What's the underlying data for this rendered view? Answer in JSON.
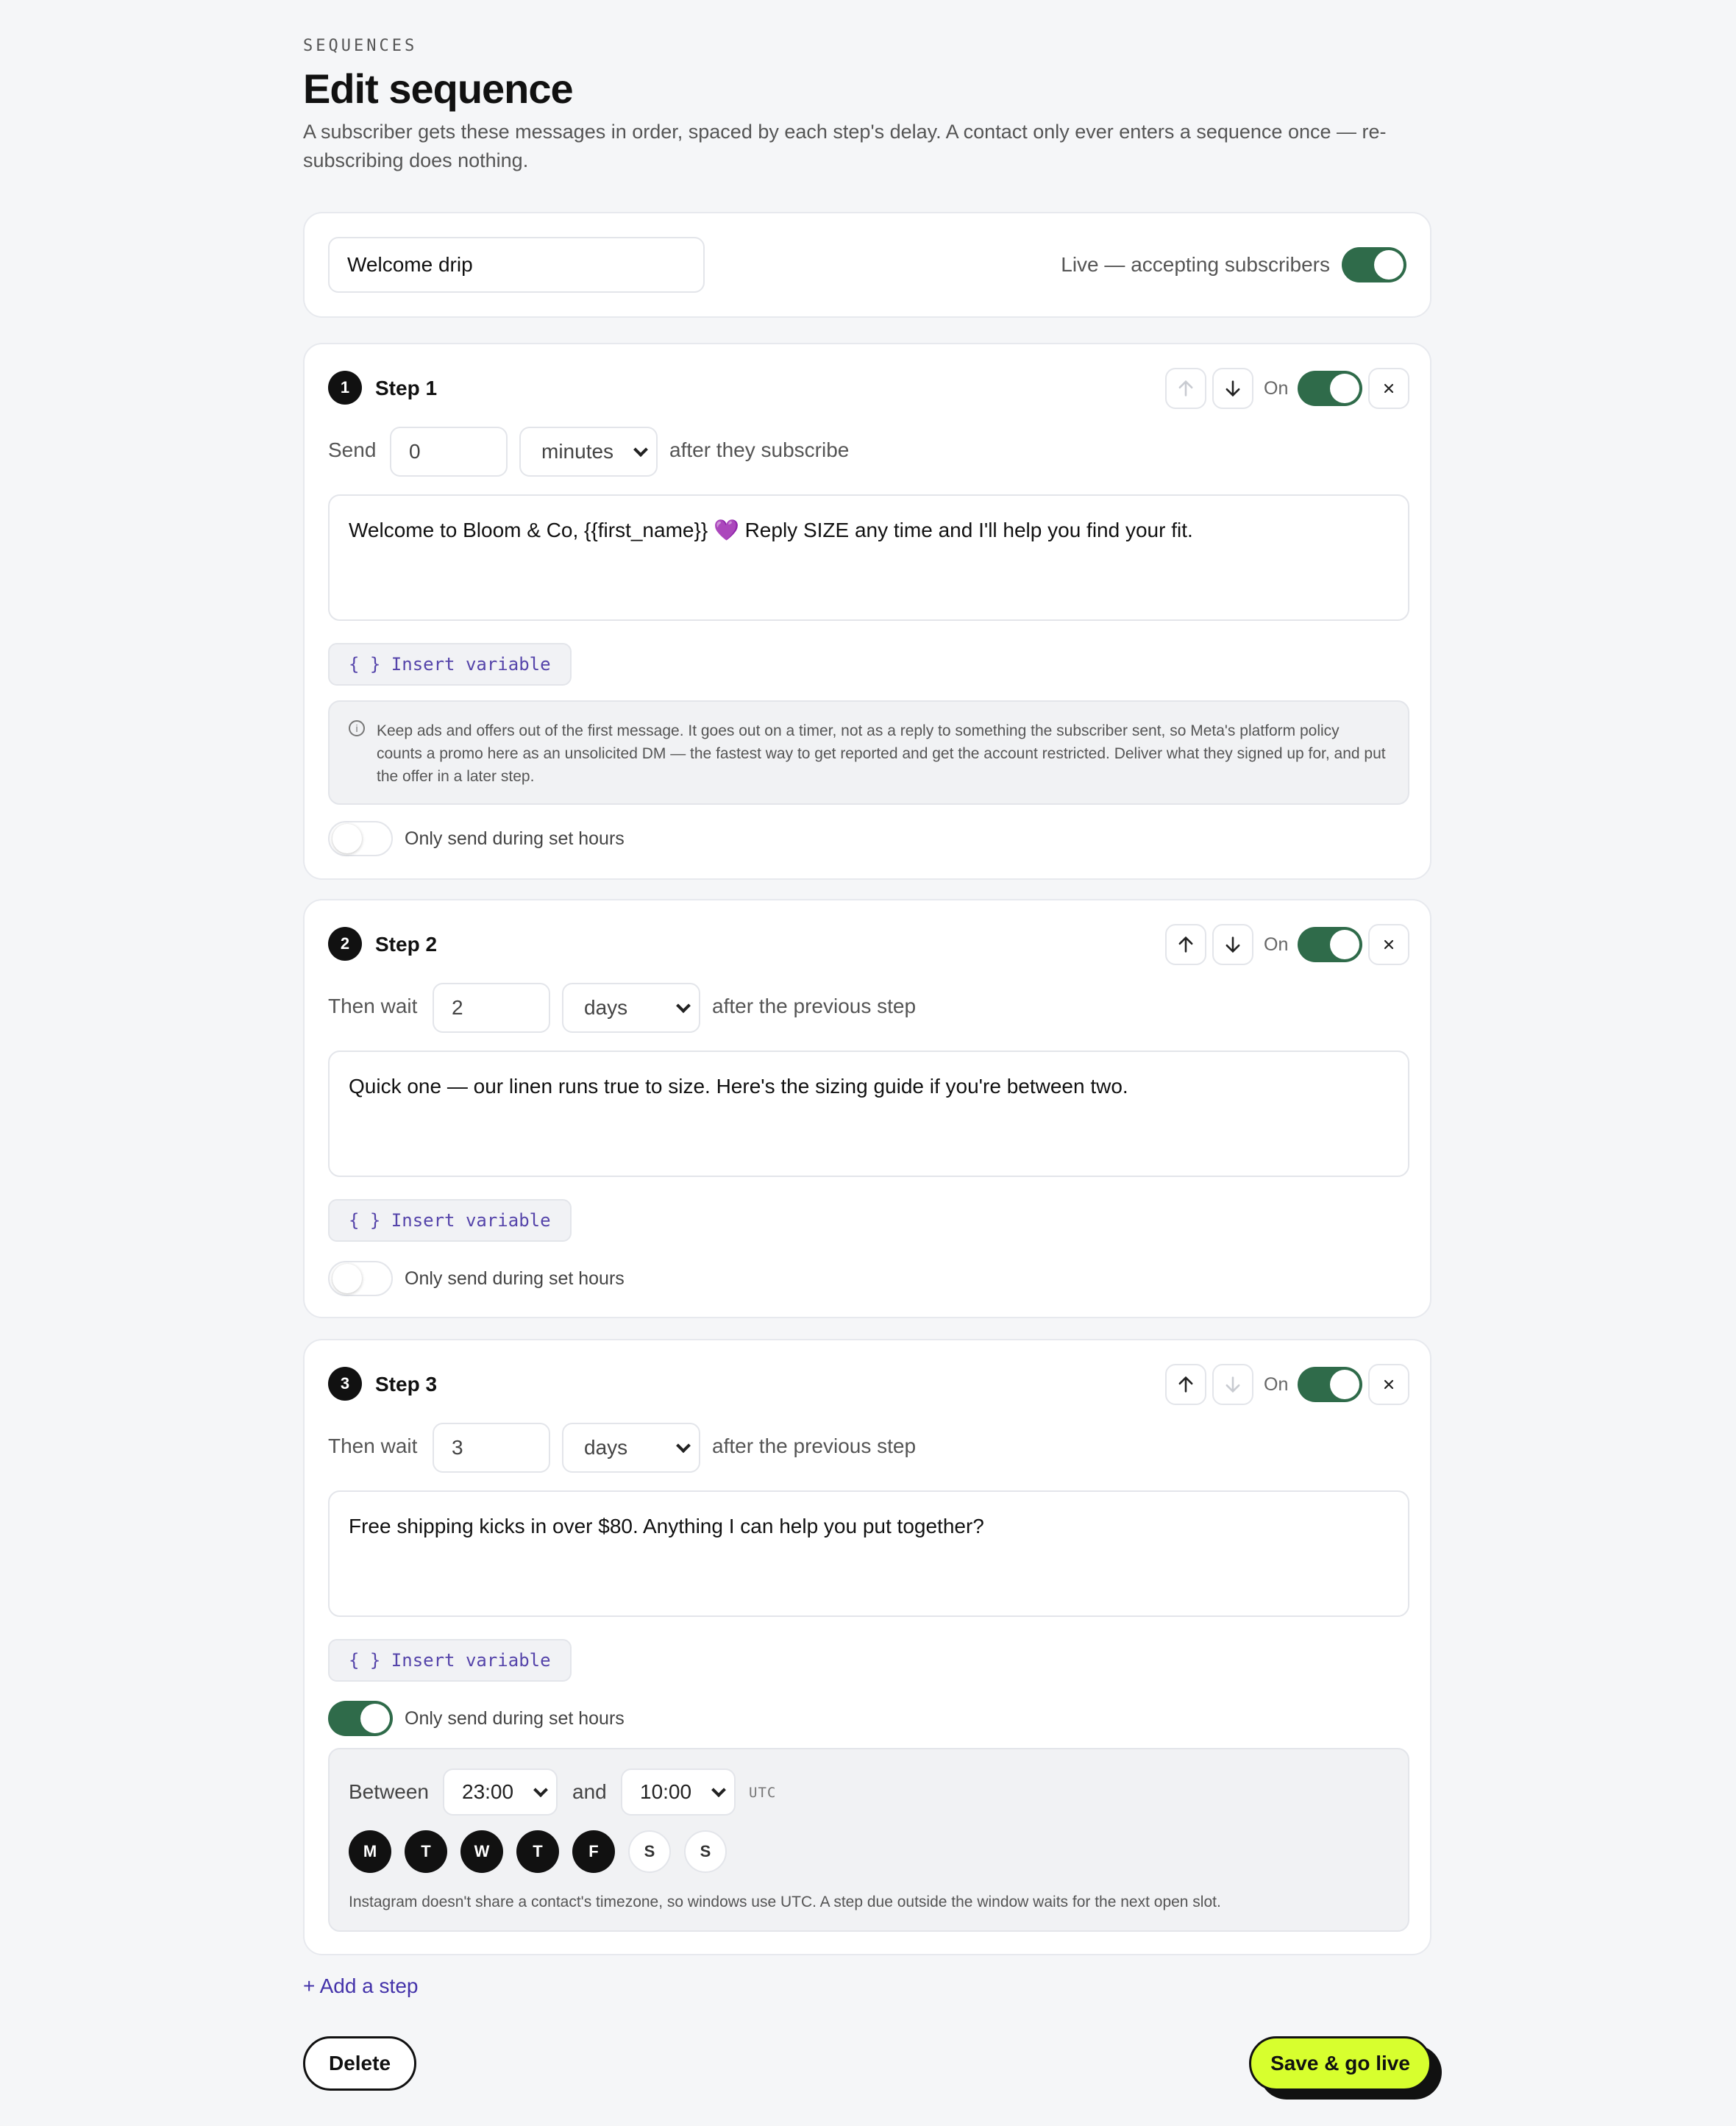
{
  "header": {
    "eyebrow": "SEQUENCES",
    "title": "Edit sequence",
    "description": "A subscriber gets these messages in order, spaced by each step's delay. A contact only ever enters a sequence once — re-subscribing does nothing."
  },
  "sequence": {
    "name": "Welcome drip",
    "live_label": "Live — accepting subscribers",
    "live": true
  },
  "common": {
    "on_label": "On",
    "insert_variable": "{ } Insert variable",
    "hours_toggle_label": "Only send during set hours"
  },
  "steps": [
    {
      "number": "1",
      "title": "Step 1",
      "delay_prefix": "Send",
      "delay_value": "0",
      "delay_unit": "minutes",
      "delay_suffix": "after they subscribe",
      "message": "Welcome to Bloom & Co, {{first_name}} 💜 Reply SIZE any time and I'll help you find your fit.",
      "enabled": true,
      "move_up_enabled": false,
      "move_down_enabled": true,
      "warning": "Keep ads and offers out of the first message. It goes out on a timer, not as a reply to something the subscriber sent, so Meta's platform policy counts a promo here as an unsolicited DM — the fastest way to get reported and get the account restricted. Deliver what they signed up for, and put the offer in a later step.",
      "hours_only": false
    },
    {
      "number": "2",
      "title": "Step 2",
      "delay_prefix": "Then wait",
      "delay_value": "2",
      "delay_unit": "days",
      "delay_suffix": "after the previous step",
      "message": "Quick one — our linen runs true to size. Here's the sizing guide if you're between two.",
      "enabled": true,
      "move_up_enabled": true,
      "move_down_enabled": true,
      "hours_only": false
    },
    {
      "number": "3",
      "title": "Step 3",
      "delay_prefix": "Then wait",
      "delay_value": "3",
      "delay_unit": "days",
      "delay_suffix": "after the previous step",
      "message": "Free shipping kicks in over $80. Anything I can help you put together?",
      "enabled": true,
      "move_up_enabled": true,
      "move_down_enabled": false,
      "hours_only": true,
      "hours": {
        "between_label": "Between",
        "start": "23:00",
        "and_label": "and",
        "end": "10:00",
        "tz": "UTC",
        "days": [
          {
            "label": "M",
            "active": true
          },
          {
            "label": "T",
            "active": true
          },
          {
            "label": "W",
            "active": true
          },
          {
            "label": "T",
            "active": true
          },
          {
            "label": "F",
            "active": true
          },
          {
            "label": "S",
            "active": false
          },
          {
            "label": "S",
            "active": false
          }
        ],
        "note": "Instagram doesn't share a contact's timezone, so windows use UTC. A step due outside the window waits for the next open slot."
      }
    }
  ],
  "footer": {
    "add_step": "+ Add a step",
    "delete": "Delete",
    "save": "Save & go live"
  },
  "colors": {
    "toggle_on": "#2f6b4a",
    "accent_link": "#4433aa",
    "save_button": "#d7ff2e"
  },
  "icons": {
    "move_up": "arrow-up-icon",
    "move_down": "arrow-down-icon",
    "remove": "close-icon",
    "info": "info-icon",
    "select_caret": "chevron-down-icon"
  }
}
